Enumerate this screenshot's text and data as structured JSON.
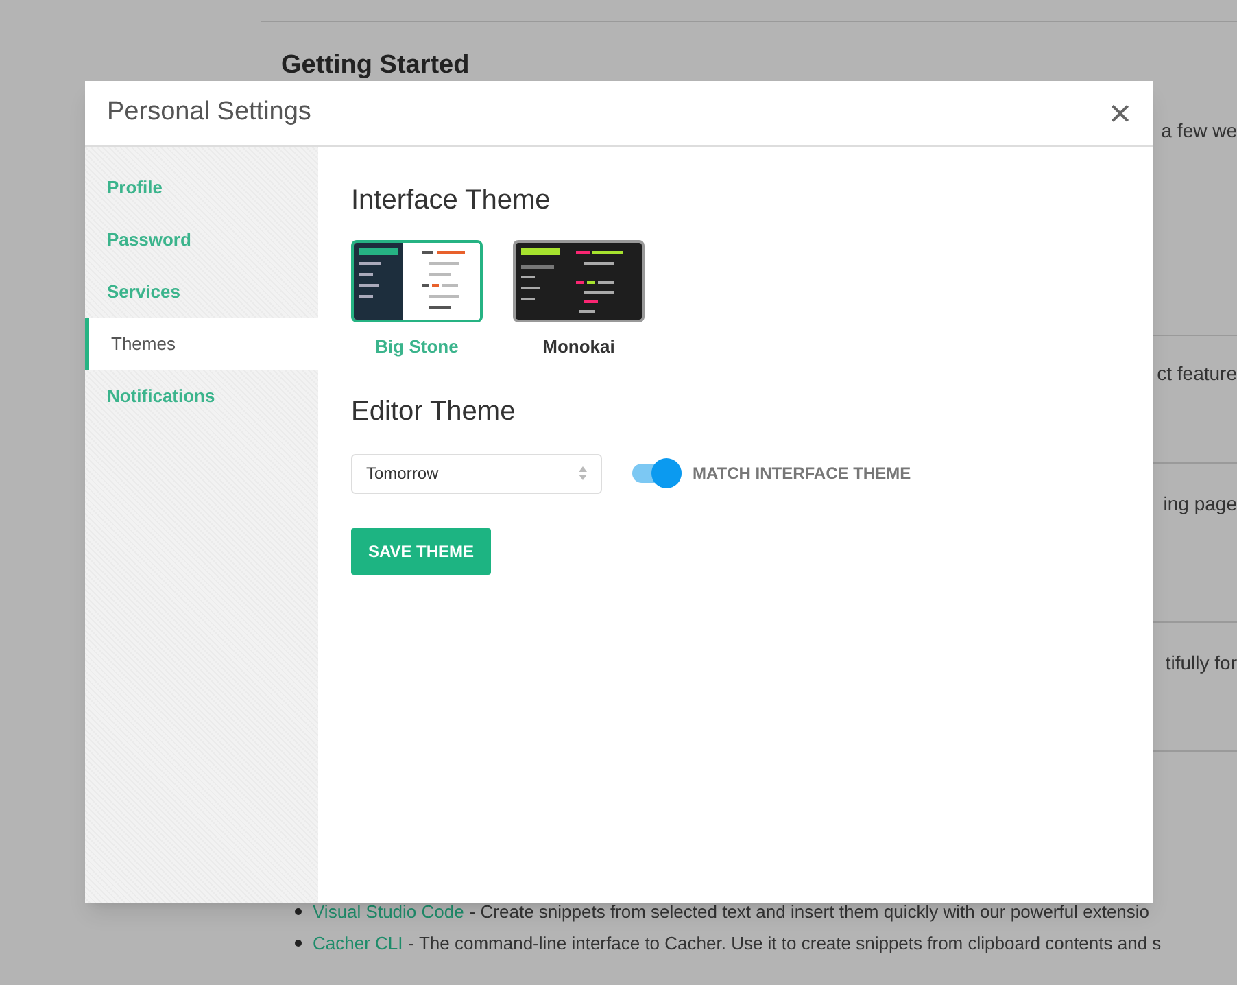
{
  "background_page": {
    "heading": "Getting Started",
    "fragments": [
      "a few we",
      "ct feature",
      "ing page",
      "tifully for"
    ],
    "links": [
      {
        "link": "Visual Studio Code",
        "text": "- Create snippets from selected text and insert them quickly with our powerful extensio"
      },
      {
        "link": "Cacher CLI",
        "text": "- The command-line interface to Cacher. Use it to create snippets from clipboard contents and s"
      }
    ]
  },
  "dialog": {
    "title": "Personal Settings",
    "close": "×",
    "sidebar": {
      "items": [
        {
          "label": "Profile",
          "selected": false
        },
        {
          "label": "Password",
          "selected": false
        },
        {
          "label": "Services",
          "selected": false
        },
        {
          "label": "Themes",
          "selected": true
        },
        {
          "label": "Notifications",
          "selected": false
        }
      ]
    },
    "interface_theme": {
      "heading": "Interface Theme",
      "themes": [
        {
          "label": "Big Stone",
          "kind": "light",
          "selected": true
        },
        {
          "label": "Monokai",
          "kind": "dark",
          "selected": false
        }
      ]
    },
    "editor_theme": {
      "heading": "Editor Theme",
      "select": {
        "value": "Tomorrow"
      },
      "toggle": {
        "label": "MATCH INTERFACE THEME",
        "on": true
      }
    },
    "save_button": "SAVE THEME"
  }
}
